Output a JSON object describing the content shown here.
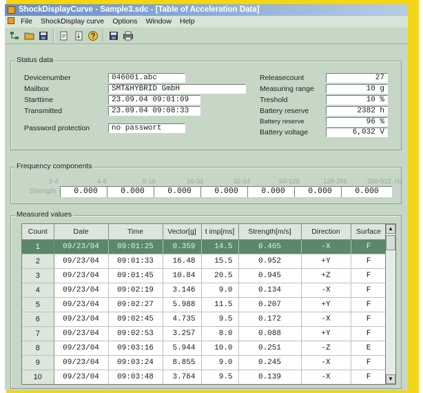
{
  "window": {
    "title": "ShockDisplayCurve - Sample3.sdc - [Table of Acceleration Data]"
  },
  "menu": [
    "File",
    "ShockDisplay curve",
    "Options",
    "Window",
    "Help"
  ],
  "toolbar": {
    "icons": [
      "tree-icon",
      "open-folder-icon",
      "save-icon",
      "export-icon",
      "import-icon",
      "help-icon",
      "save-file-icon",
      "print-icon"
    ]
  },
  "status": {
    "title": "Status data",
    "left": [
      {
        "label": "Devicenumber",
        "value": "046001.abc"
      },
      {
        "label": "Mailbox",
        "value": "SMT&HYBRID GmbH"
      },
      {
        "label": "Starttime",
        "value": "23.09.04 09:01:09"
      },
      {
        "label": "Transmitted",
        "value": "23.09.04 09:08:33"
      },
      {
        "label": "Password protection",
        "value": "no passwort"
      }
    ],
    "right": [
      {
        "label": "Releasecount",
        "value": "27"
      },
      {
        "label": "Measuring range",
        "value": "10 g"
      },
      {
        "label": "Treshold",
        "value": "10 %"
      },
      {
        "label": "Battery reserve",
        "value": "2382 h"
      },
      {
        "label": "Battery reserve",
        "value": "96 %"
      },
      {
        "label": "Battery voltage",
        "value": "6,032 V"
      }
    ]
  },
  "frequency": {
    "title": "Frequency components",
    "row_label": "Strength",
    "unit": "Hz",
    "bands": [
      "2-4",
      "4-8",
      "8-16",
      "16-32",
      "32-64",
      "64-128",
      "128-256",
      "256-512"
    ],
    "values": [
      "0.000",
      "0.000",
      "0.000",
      "0.000",
      "0.000",
      "0.000",
      "0.000",
      "0.000"
    ]
  },
  "measured": {
    "title": "Measured values",
    "columns": [
      "Count",
      "Date",
      "Time",
      "Vector[g]",
      "t imp[ms]",
      "Strength[m/s]",
      "Direction",
      "Surface"
    ],
    "rows": [
      [
        "1",
        "09/23/04",
        "09:01:25",
        "0.359",
        "14.5",
        "0.405",
        "-X",
        "F"
      ],
      [
        "2",
        "09/23/04",
        "09:01:33",
        "16.48",
        "15.5",
        "0.952",
        "+Y",
        "F"
      ],
      [
        "3",
        "09/23/04",
        "09:01:45",
        "10.84",
        "20.5",
        "0.945",
        "+Z",
        "F"
      ],
      [
        "4",
        "09/23/04",
        "09:02:19",
        "3.146",
        "9.0",
        "0.134",
        "-X",
        "F"
      ],
      [
        "5",
        "09/23/04",
        "09:02:27",
        "5.988",
        "11.5",
        "0.207",
        "+Y",
        "F"
      ],
      [
        "6",
        "09/23/04",
        "09:02:45",
        "4.735",
        "9.5",
        "0.172",
        "-X",
        "F"
      ],
      [
        "7",
        "09/23/04",
        "09:02:53",
        "3.257",
        "8.0",
        "0.088",
        "+Y",
        "F"
      ],
      [
        "8",
        "09/23/04",
        "09:03:16",
        "5.944",
        "10.0",
        "0.251",
        "-Z",
        "E"
      ],
      [
        "9",
        "09/23/04",
        "09:03:24",
        "8.855",
        "9.0",
        "0.245",
        "-X",
        "F"
      ],
      [
        "10",
        "09/23/04",
        "09:03:48",
        "3.764",
        "9.5",
        "0.139",
        "-X",
        "F"
      ]
    ],
    "selected_row": 1
  },
  "colors": {
    "window_bg": "#c6d7c6",
    "frame": "#f2d617",
    "selected_row": "#5a8868",
    "title_bar": "#6a8ec4"
  }
}
